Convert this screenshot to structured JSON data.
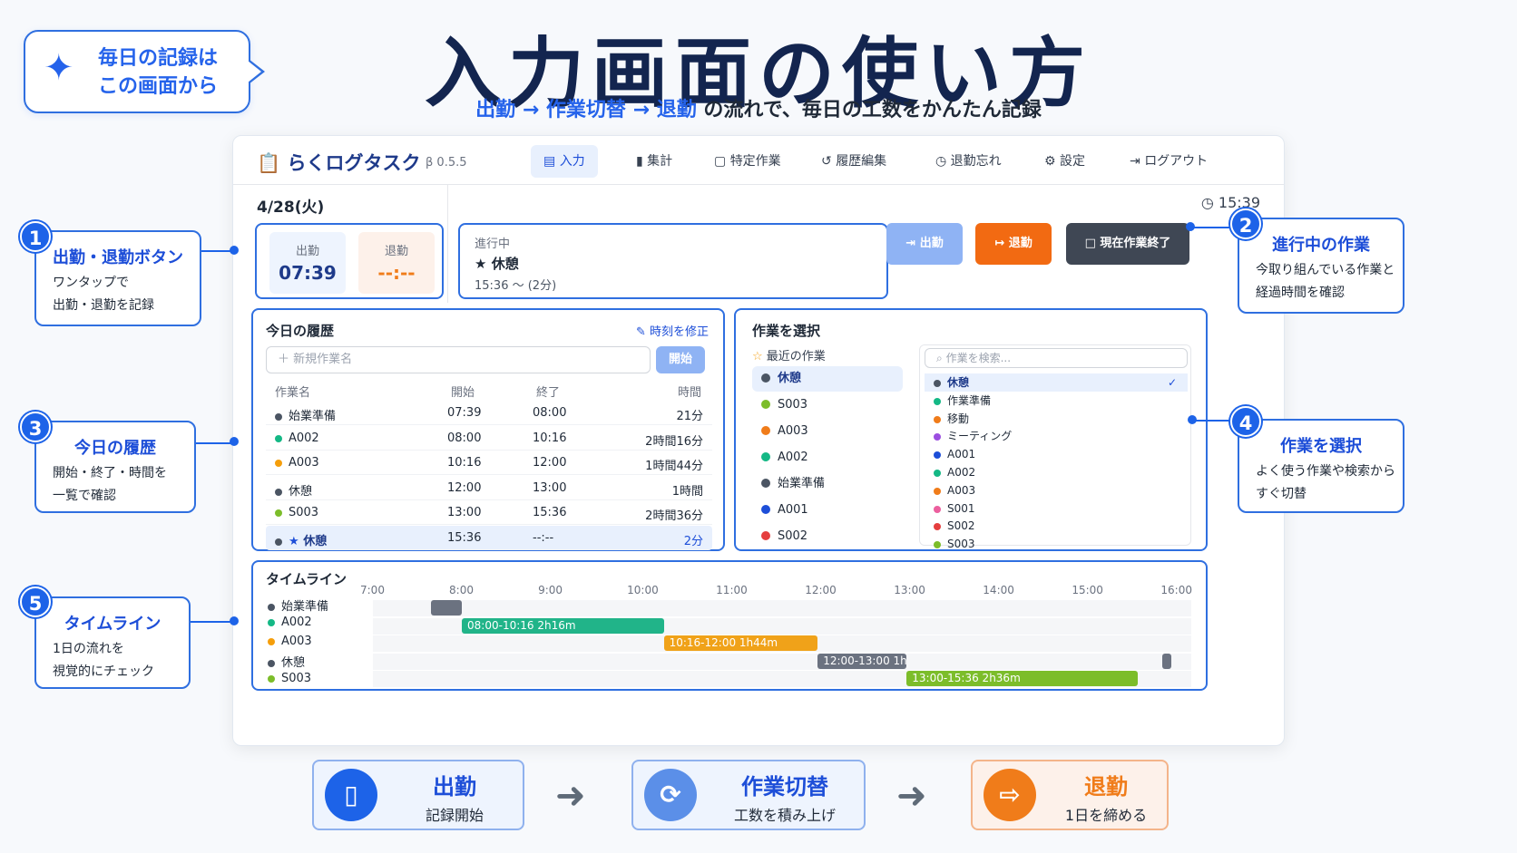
{
  "header": {
    "title": "入力画面の使い方",
    "subtitle": {
      "step1": "出勤",
      "arrow": "→",
      "step2": "作業切替",
      "step3": "退勤",
      "rest": "の流れで、毎日の工数をかんたん記録"
    }
  },
  "bubble": {
    "line1": "毎日の記録は",
    "line2": "この画面から",
    "icon": "sparkle-icon"
  },
  "app": {
    "logo": "らくログタスク",
    "version": "β 0.5.5",
    "nav": [
      "入力",
      "集計",
      "特定作業",
      "履歴編集",
      "退勤忘れ",
      "設定",
      "ログアウト"
    ],
    "nav_icons": [
      "clipboard-icon",
      "bar-chart-icon",
      "book-icon",
      "history-icon",
      "clock-icon",
      "gear-icon",
      "logout-icon"
    ],
    "date": "4/28(火)",
    "clock": "15:39",
    "clock_in": {
      "label": "出勤",
      "time": "07:39"
    },
    "clock_out": {
      "label": "退勤",
      "time": "--:--"
    },
    "in_progress": {
      "label": "進行中",
      "task": "休憩",
      "detail": "15:36 〜 (2分)"
    },
    "buttons": {
      "in": "出勤",
      "out": "退勤",
      "finish": "現在作業終了"
    },
    "history": {
      "title": "今日の履歴",
      "edit": "時刻を修正",
      "placeholder": "新規作業名",
      "start_button": "開始",
      "headers": [
        "作業名",
        "開始",
        "終了",
        "時間"
      ],
      "rows": [
        {
          "name": "始業準備",
          "start": "07:39",
          "end": "08:00",
          "dur": "21分",
          "color": "#4b5563"
        },
        {
          "name": "A002",
          "start": "08:00",
          "end": "10:16",
          "dur": "2時間16分",
          "color": "#14b885"
        },
        {
          "name": "A003",
          "start": "10:16",
          "end": "12:00",
          "dur": "1時間44分",
          "color": "#f59e0b"
        },
        {
          "name": "休憩",
          "start": "12:00",
          "end": "13:00",
          "dur": "1時間",
          "color": "#4b5563"
        },
        {
          "name": "S003",
          "start": "13:00",
          "end": "15:36",
          "dur": "2時間36分",
          "color": "#7cbd2a"
        },
        {
          "name": "休憩",
          "start": "15:36",
          "end": "--:--",
          "dur": "2分",
          "color": "#4b5563"
        }
      ]
    },
    "select": {
      "title": "作業を選択",
      "recent_label": "最近の作業",
      "recent": [
        {
          "name": "休憩",
          "color": "#4b5563"
        },
        {
          "name": "S003",
          "color": "#7cbd2a"
        },
        {
          "name": "A003",
          "color": "#f07c1a"
        },
        {
          "name": "A002",
          "color": "#14b885"
        },
        {
          "name": "始業準備",
          "color": "#4b5563"
        },
        {
          "name": "A001",
          "color": "#1d4ed8"
        },
        {
          "name": "S002",
          "color": "#e53e3e"
        }
      ],
      "search_placeholder": "作業を検索...",
      "list": [
        {
          "name": "休憩",
          "color": "#4b5563"
        },
        {
          "name": "作業準備",
          "color": "#14b885"
        },
        {
          "name": "移動",
          "color": "#f07c1a"
        },
        {
          "name": "ミーティング",
          "color": "#9b4ee0"
        },
        {
          "name": "A001",
          "color": "#1d4ed8"
        },
        {
          "name": "A002",
          "color": "#14b885"
        },
        {
          "name": "A003",
          "color": "#f07c1a"
        },
        {
          "name": "S001",
          "color": "#ec5f9e"
        },
        {
          "name": "S002",
          "color": "#e53e3e"
        },
        {
          "name": "S003",
          "color": "#7cbd2a"
        }
      ]
    },
    "timeline": {
      "title": "タイムライン",
      "ticks": [
        "7:00",
        "8:00",
        "9:00",
        "10:00",
        "11:00",
        "12:00",
        "13:00",
        "14:00",
        "15:00",
        "16:00"
      ],
      "legend": [
        {
          "name": "始業準備",
          "color": "#4b5563"
        },
        {
          "name": "A002",
          "color": "#14b885"
        },
        {
          "name": "A003",
          "color": "#f59e0b"
        },
        {
          "name": "休憩",
          "color": "#4b5563"
        },
        {
          "name": "S003",
          "color": "#7cbd2a"
        }
      ],
      "bars": [
        {
          "row": 0,
          "start": 7.65,
          "end": 8.0,
          "label": "",
          "color": "#6b7280"
        },
        {
          "row": 1,
          "start": 8.0,
          "end": 10.27,
          "label": "08:00-10:16 2h16m",
          "color": "#21b489"
        },
        {
          "row": 2,
          "start": 10.27,
          "end": 12.0,
          "label": "10:16-12:00 1h44m",
          "color": "#f0a219"
        },
        {
          "row": 3,
          "start": 12.0,
          "end": 13.0,
          "label": "12:00-13:00 1h",
          "color": "#6b7280"
        },
        {
          "row": 3,
          "start": 15.87,
          "end": 15.98,
          "label": "",
          "color": "#6b7280"
        },
        {
          "row": 4,
          "start": 13.0,
          "end": 15.6,
          "label": "13:00-15:36 2h36m",
          "color": "#7cbd2a"
        }
      ]
    }
  },
  "callouts": [
    {
      "num": "1",
      "title": "出勤・退勤ボタン",
      "body1": "ワンタップで",
      "body2": "出勤・退勤を記録"
    },
    {
      "num": "2",
      "title": "進行中の作業",
      "body1": "今取り組んでいる作業と",
      "body2": "経過時間を確認"
    },
    {
      "num": "3",
      "title": "今日の履歴",
      "body1": "開始・終了・時間を",
      "body2": "一覧で確認"
    },
    {
      "num": "4",
      "title": "作業を選択",
      "body1": "よく使う作業や検索から",
      "body2": "すぐ切替"
    },
    {
      "num": "5",
      "title": "タイムライン",
      "body1": "1日の流れを",
      "body2": "視覚的にチェック"
    }
  ],
  "flow": [
    {
      "title": "出勤",
      "sub": "記録開始",
      "color": "#1d63e8",
      "icon": "door-icon"
    },
    {
      "title": "作業切替",
      "sub": "工数を積み上げ",
      "color": "#5b8fe8",
      "icon": "refresh-icon"
    },
    {
      "title": "退勤",
      "sub": "1日を締める",
      "color": "#f07c1a",
      "icon": "exit-icon"
    }
  ]
}
